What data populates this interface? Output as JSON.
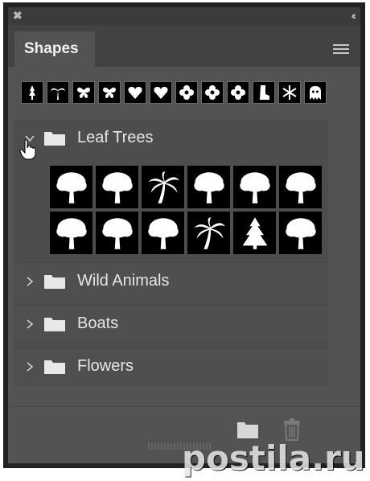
{
  "panel": {
    "close_icon": "close-icon",
    "collapse_icon": "double-chevron-left-icon",
    "tab_label": "Shapes",
    "menu_icon": "hamburger-menu-icon"
  },
  "recent_shapes": [
    "tree",
    "palm-tree",
    "butterfly",
    "butterfly",
    "heart",
    "heart",
    "flower",
    "flower",
    "flower",
    "boot",
    "snowflake",
    "ghost"
  ],
  "groups": [
    {
      "label": "Leaf Trees",
      "expanded": true,
      "shapes": [
        "tree-1",
        "tree-2",
        "palm-1",
        "tree-3",
        "tree-4",
        "tree-5",
        "tree-6",
        "tree-7",
        "tree-8",
        "palm-2",
        "pine",
        "tree-9"
      ]
    },
    {
      "label": "Wild Animals",
      "expanded": false
    },
    {
      "label": "Boats",
      "expanded": false
    },
    {
      "label": "Flowers",
      "expanded": false
    }
  ],
  "footer": {
    "new_group_icon": "folder-icon",
    "delete_icon": "trash-icon"
  },
  "watermark": "postila.ru",
  "colors": {
    "panel_bg": "#535353",
    "list_bg": "#4d4d4d",
    "text": "#e6e6e6"
  }
}
